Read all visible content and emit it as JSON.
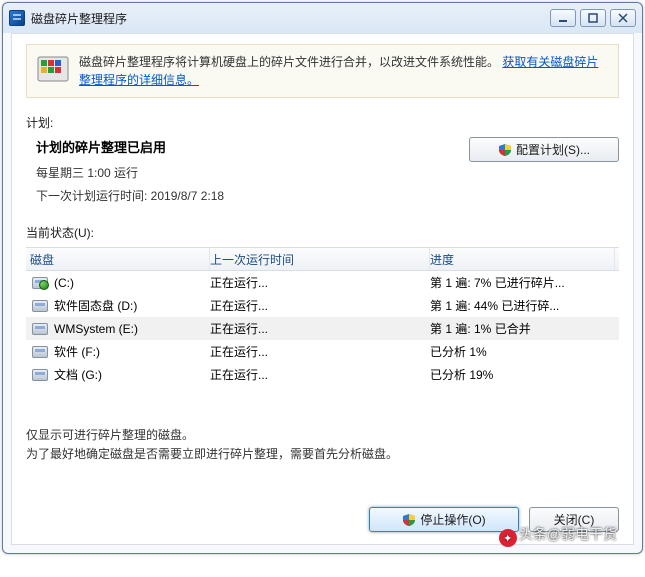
{
  "window": {
    "title": "磁盘碎片整理程序"
  },
  "info": {
    "text_before_link": "磁盘碎片整理程序将计算机硬盘上的碎片文件进行合并，以改进文件系统性能。",
    "link_text": "获取有关磁盘碎片整理程序的详细信息。"
  },
  "plan": {
    "label": "计划:",
    "title": "计划的碎片整理已启用",
    "schedule": "每星期三 1:00 运行",
    "next_run": "下一次计划运行时间: 2019/8/7 2:18",
    "config_button": "配置计划(S)..."
  },
  "status_label": "当前状态(U):",
  "table": {
    "headers": {
      "disk": "磁盘",
      "last": "上一次运行时间",
      "progress": "进度"
    },
    "rows": [
      {
        "name": "(C:)",
        "os": true,
        "last": "正在运行...",
        "progress": "第 1 遍: 7% 已进行碎片...",
        "selected": false
      },
      {
        "name": "软件固态盘 (D:)",
        "os": false,
        "last": "正在运行...",
        "progress": "第 1 遍: 44% 已进行碎...",
        "selected": false
      },
      {
        "name": "WMSystem (E:)",
        "os": false,
        "last": "正在运行...",
        "progress": "第 1 遍: 1% 已合并",
        "selected": true
      },
      {
        "name": "软件 (F:)",
        "os": false,
        "last": "正在运行...",
        "progress": "已分析 1%",
        "selected": false
      },
      {
        "name": "文档 (G:)",
        "os": false,
        "last": "正在运行...",
        "progress": "已分析 19%",
        "selected": false
      }
    ]
  },
  "hint": {
    "line1": "仅显示可进行碎片整理的磁盘。",
    "line2": "为了最好地确定磁盘是否需要立即进行碎片整理，需要首先分析磁盘。"
  },
  "buttons": {
    "stop": "停止操作(O)",
    "close": "关闭(C)"
  },
  "watermark": {
    "prefix": "头条",
    "text": "@弱电干货"
  }
}
